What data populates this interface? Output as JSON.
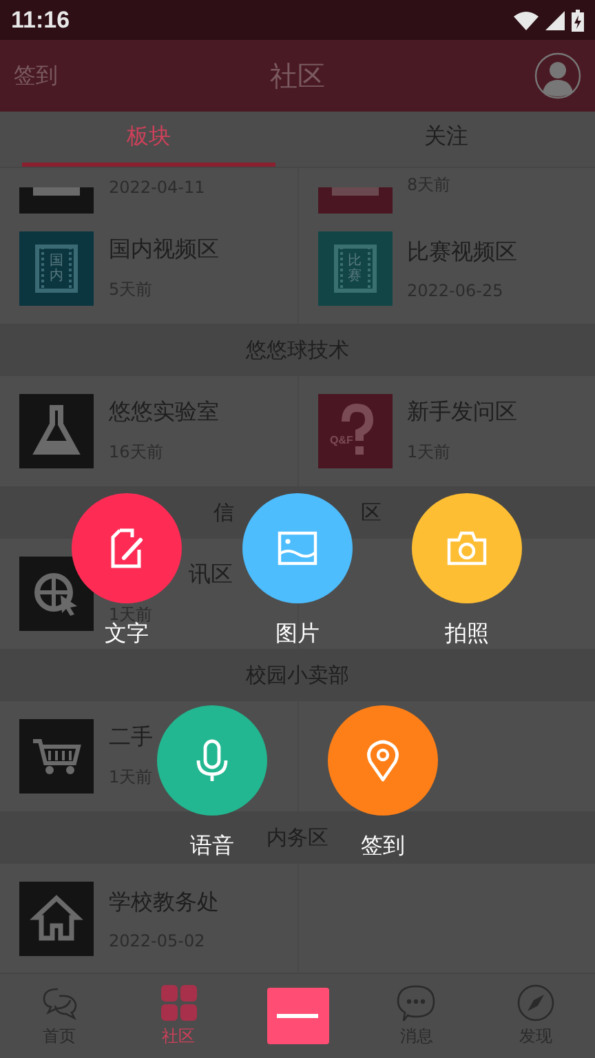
{
  "status_bar": {
    "time": "11:16"
  },
  "header": {
    "left_action": "签到",
    "title": "社区"
  },
  "tabs": [
    {
      "label": "板块",
      "selected": true
    },
    {
      "label": "关注",
      "selected": false
    }
  ],
  "sections": [
    {
      "items": [
        {
          "time": "2022-04-11",
          "color": "#141414",
          "partial": true
        },
        {
          "time": "8天前",
          "color": "#4a1622",
          "partial": true
        }
      ]
    },
    {
      "items": [
        {
          "title": "国内视频区",
          "time": "5天前",
          "color": "#0b3640",
          "icon_label": "国内"
        },
        {
          "title": "比赛视频区",
          "time": "2022-06-25",
          "color": "#124646",
          "icon_label": "比赛"
        }
      ]
    },
    {
      "title": "悠悠球技术",
      "items": [
        {
          "title": "悠悠实验室",
          "time": "16天前",
          "color": "#141414"
        },
        {
          "title": "新手发问区",
          "time": "1天前",
          "color": "#4a1622",
          "icon_label": "Q&F"
        }
      ]
    },
    {
      "title_parts": [
        "信",
        "区"
      ],
      "items": [
        {
          "title": "讯区",
          "time": "1天前",
          "color": "#141414",
          "start_hidden": true
        }
      ]
    },
    {
      "title": "校园小卖部",
      "items": [
        {
          "title": "二手",
          "time": "1天前",
          "color": "#141414"
        }
      ]
    },
    {
      "title": "内务区",
      "items": [
        {
          "title": "学校教务处",
          "time": "2022-05-02",
          "color": "#141414"
        }
      ]
    }
  ],
  "popup_actions": [
    {
      "label": "文字",
      "color": "#fe2c55"
    },
    {
      "label": "图片",
      "color": "#4dbdfe"
    },
    {
      "label": "拍照",
      "color": "#febe33"
    },
    {
      "label": "语音",
      "color": "#22b790"
    },
    {
      "label": "签到",
      "color": "#fe7f17"
    }
  ],
  "bottom_nav": [
    {
      "kind": "tab",
      "label": "首页",
      "selected": false
    },
    {
      "kind": "tab",
      "label": "社区",
      "selected": true
    },
    {
      "kind": "action"
    },
    {
      "kind": "tab",
      "label": "消息",
      "selected": false
    },
    {
      "kind": "tab",
      "label": "发现",
      "selected": false
    }
  ]
}
